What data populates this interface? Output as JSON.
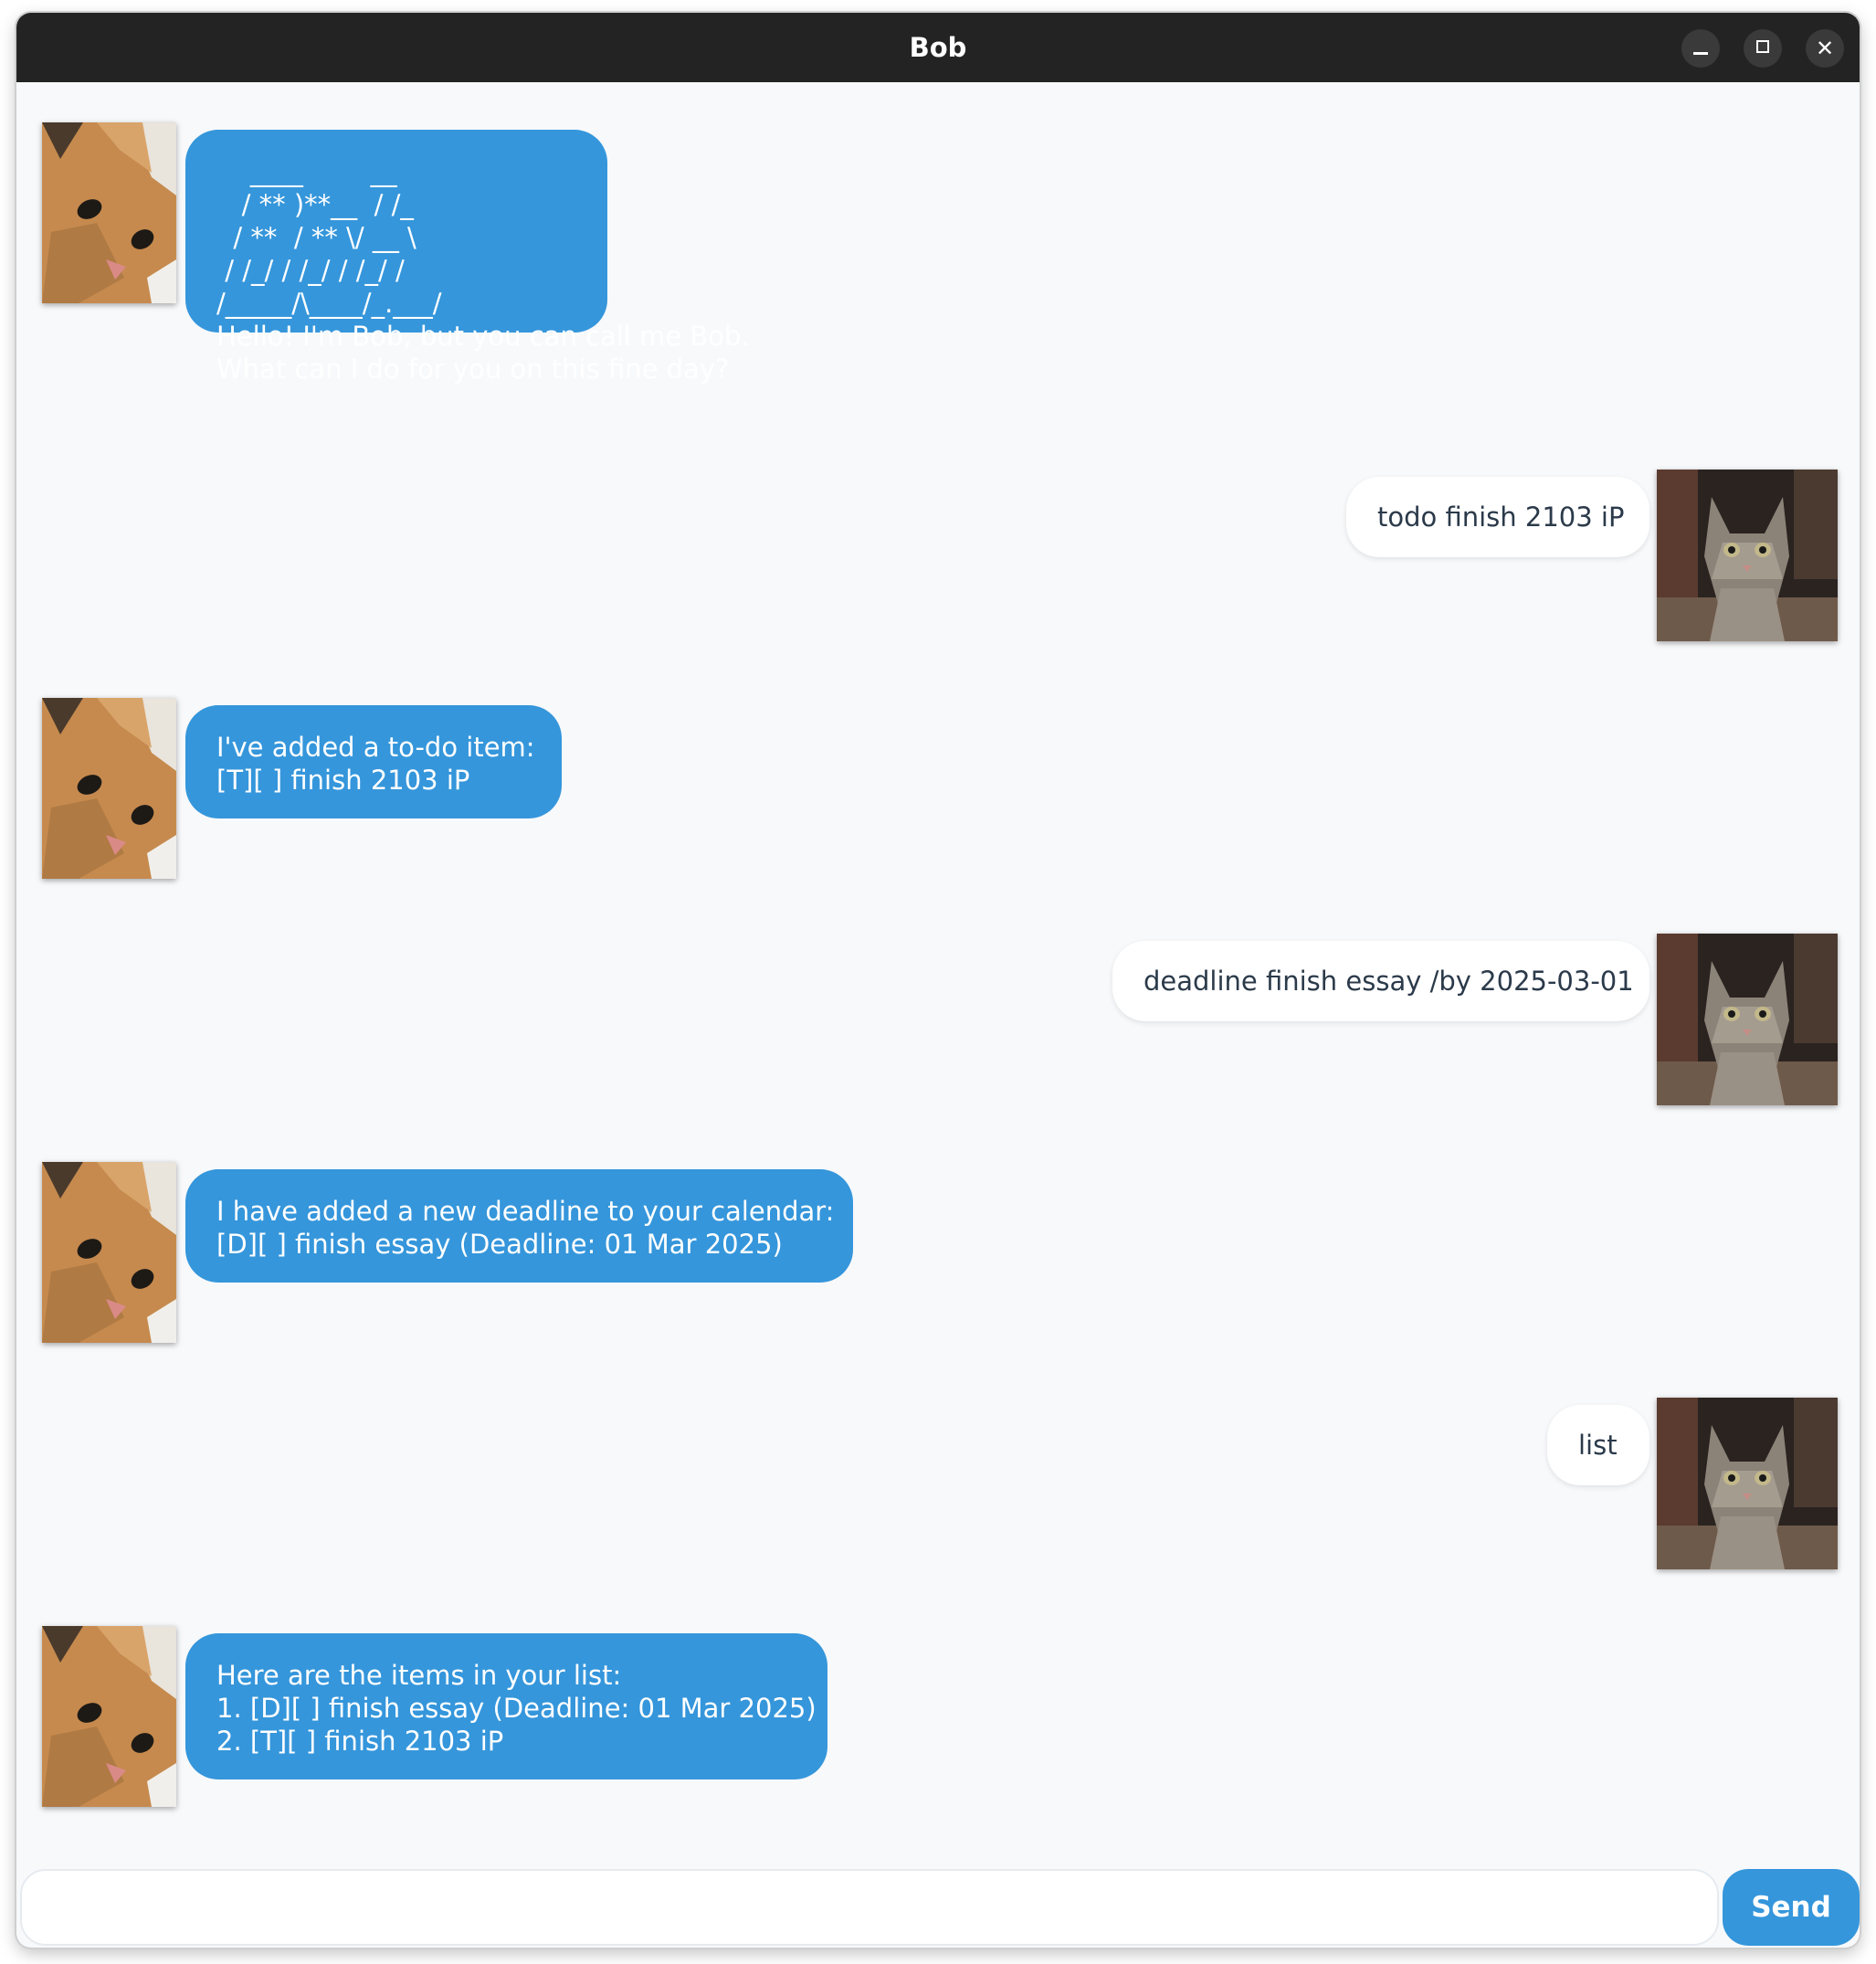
{
  "window": {
    "title": "Bob",
    "controls": [
      "minimize",
      "maximize",
      "close"
    ]
  },
  "icons": {
    "close": "✕"
  },
  "messages": [
    {
      "sender": "bot",
      "avatar": "orange-cat-avatar",
      "text": "    ____        __\n   / ** )**__  / /_\n  / **  / ** \\/ __ \\\n / /_/ / /_/ / /_/ /\n/_____/\\____/_.___/\nHello! I'm Bob, but you can call me Bob.\nWhat can I do for you on this fine day?"
    },
    {
      "sender": "user",
      "avatar": "tabby-cat-avatar",
      "text": "todo finish 2103 iP"
    },
    {
      "sender": "bot",
      "avatar": "orange-cat-avatar",
      "text": "I've added a to-do item:\n[T][ ] finish 2103 iP"
    },
    {
      "sender": "user",
      "avatar": "tabby-cat-avatar",
      "text": "deadline finish essay /by 2025-03-01"
    },
    {
      "sender": "bot",
      "avatar": "orange-cat-avatar",
      "text": "I have added a new deadline to your calendar:\n[D][ ] finish essay (Deadline: 01 Mar 2025)"
    },
    {
      "sender": "user",
      "avatar": "tabby-cat-avatar",
      "text": "list"
    },
    {
      "sender": "bot",
      "avatar": "orange-cat-avatar",
      "text": "Here are the items in your list:\n1. [D][ ] finish essay (Deadline: 01 Mar 2025)\n2. [T][ ] finish 2103 iP"
    }
  ],
  "input": {
    "value": "",
    "placeholder": ""
  },
  "send_button": {
    "label": "Send"
  },
  "colors": {
    "titlebar": "#232323",
    "background": "#f8f9fb",
    "bot_bubble": "#3596db",
    "user_bubble": "#ffffff",
    "user_text": "#2b3a4a",
    "send_button": "#3596db"
  }
}
